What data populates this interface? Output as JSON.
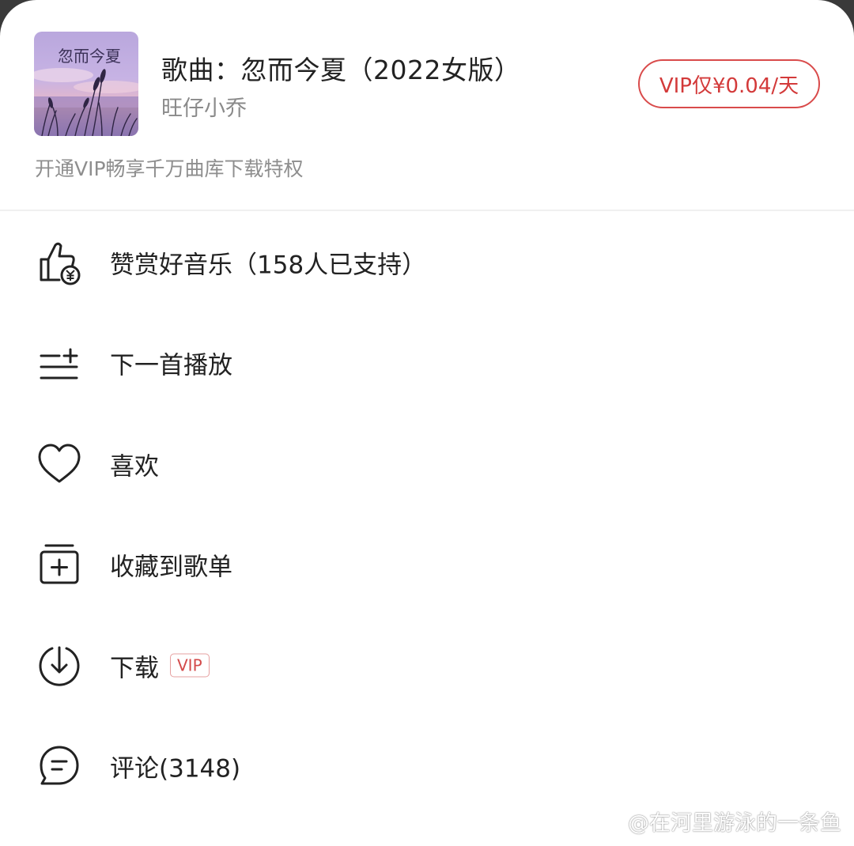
{
  "song": {
    "title": "歌曲：忽而今夏（2022女版）",
    "artist": "旺仔小乔",
    "cover_text": "忽而今夏"
  },
  "vip": {
    "button_label": "VIP仅¥0.04/天",
    "promo_text": "开通VIP畅享千万曲库下载特权"
  },
  "menu": {
    "items": [
      {
        "label": "赞赏好音乐（158人已支持）",
        "icon": "reward-thumbs-up-icon"
      },
      {
        "label": "下一首播放",
        "icon": "play-next-icon"
      },
      {
        "label": "喜欢",
        "icon": "heart-icon"
      },
      {
        "label": "收藏到歌单",
        "icon": "add-to-playlist-icon"
      },
      {
        "label": "下载",
        "icon": "download-icon",
        "tag": "VIP"
      },
      {
        "label": "评论(3148)",
        "icon": "comment-icon"
      }
    ]
  },
  "watermark": {
    "text": "@在河里游泳的一条鱼"
  },
  "colors": {
    "accent": "#d94b4b",
    "text": "#222222",
    "secondary": "#8a8a8a",
    "background": "#ffffff"
  }
}
